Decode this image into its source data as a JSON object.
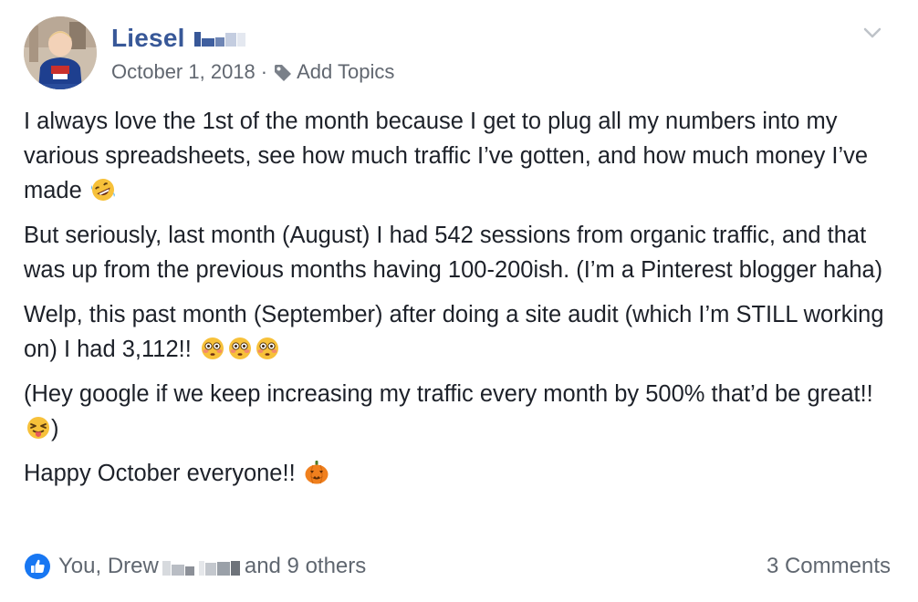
{
  "post": {
    "author": {
      "name": "Liesel",
      "avatar": "avatar-photo-child"
    },
    "date": "October 1, 2018",
    "separator": "·",
    "add_topics_label": "Add Topics",
    "menu_icon": "chevron-down-icon",
    "paragraphs": [
      {
        "text": "I always love the 1st of the month because I get to plug all my numbers into my various spreadsheets, see how much traffic I’ve gotten, and how much money I’ve made",
        "emojis": [
          "rofl-emoji"
        ]
      },
      {
        "text": "But seriously, last month (August) I had 542 sessions from organic traffic, and that was up from the previous months having 100-200ish. (I’m a Pinterest blogger haha)",
        "emojis": []
      },
      {
        "text": "Welp, this past month (September) after doing a site audit (which I’m STILL working on) I had 3,112!!",
        "emojis": [
          "flushed-emoji",
          "flushed-emoji",
          "flushed-emoji"
        ]
      },
      {
        "text": "(Hey google if we keep increasing my traffic every month by 500% that’d be great!!",
        "text_after": ")",
        "emojis": [
          "tongue-wink-emoji"
        ]
      },
      {
        "text": "Happy October everyone!!",
        "emojis": [
          "jack-o-lantern-emoji"
        ]
      }
    ]
  },
  "footer": {
    "reactions_prefix": "You, Drew",
    "reactions_suffix": "and 9 others",
    "comments": "3 Comments",
    "like_icon": "like-thumb-icon",
    "like_color": "#1877f2"
  },
  "colors": {
    "author_name": "#385898",
    "meta": "#616770",
    "body_text": "#1d2129",
    "footer_text": "#606770"
  }
}
